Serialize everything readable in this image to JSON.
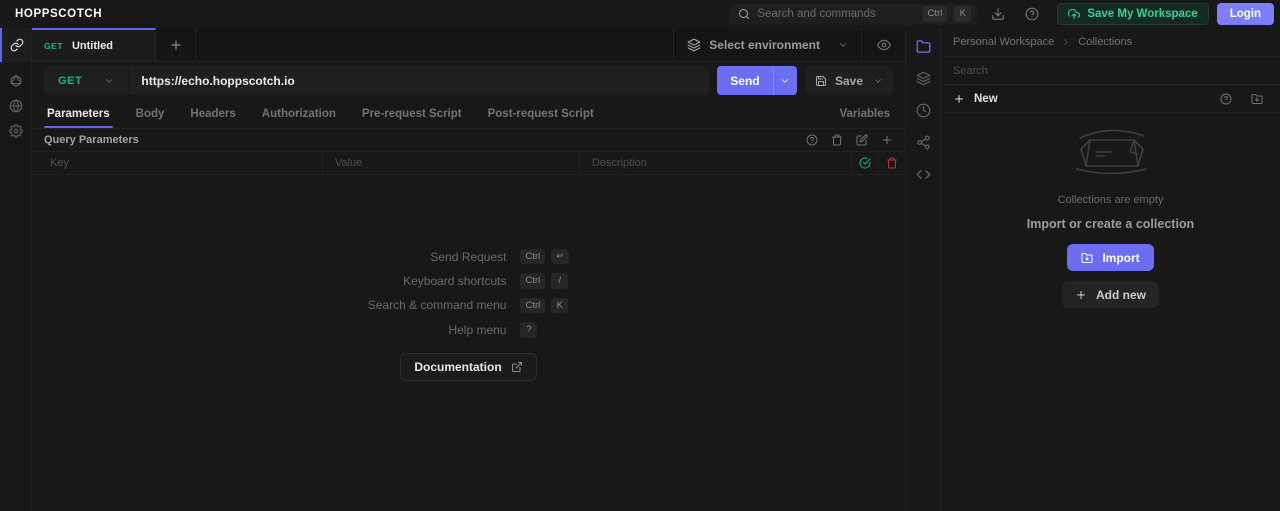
{
  "topbar": {
    "logo": "HOPPSCOTCH",
    "search": {
      "placeholder": "Search and commands",
      "keys": [
        "Ctrl",
        "K"
      ]
    },
    "save_workspace_label": "Save My Workspace",
    "login_label": "Login"
  },
  "environment": {
    "selected_label": "Select environment"
  },
  "request": {
    "tab": {
      "method": "GET",
      "title": "Untitled"
    },
    "method": "GET",
    "url": "https://echo.hoppscotch.io",
    "send_label": "Send",
    "save_label": "Save",
    "tabs": [
      "Parameters",
      "Body",
      "Headers",
      "Authorization",
      "Pre-request Script",
      "Post-request Script",
      "Variables"
    ],
    "active_tab": "Parameters",
    "params": {
      "title": "Query Parameters",
      "columns": [
        "Key",
        "Value",
        "Description"
      ],
      "rows": [
        {
          "key": "",
          "value": "",
          "description": ""
        }
      ]
    }
  },
  "shortcuts": {
    "items": [
      {
        "label": "Send Request",
        "keys": [
          "Ctrl",
          "↵"
        ]
      },
      {
        "label": "Keyboard shortcuts",
        "keys": [
          "Ctrl",
          "/"
        ]
      },
      {
        "label": "Search & command menu",
        "keys": [
          "Ctrl",
          "K"
        ]
      },
      {
        "label": "Help menu",
        "keys": [
          "?"
        ]
      }
    ],
    "documentation_label": "Documentation"
  },
  "collections": {
    "breadcrumb": [
      "Personal Workspace",
      "Collections"
    ],
    "search_placeholder": "Search",
    "new_label": "New",
    "empty_title": "Collections are empty",
    "empty_subtitle": "Import or create a collection",
    "import_label": "Import",
    "add_new_label": "Add new"
  },
  "colors": {
    "accent": "#6366f1",
    "success": "#10b981",
    "danger": "#dc2626"
  }
}
